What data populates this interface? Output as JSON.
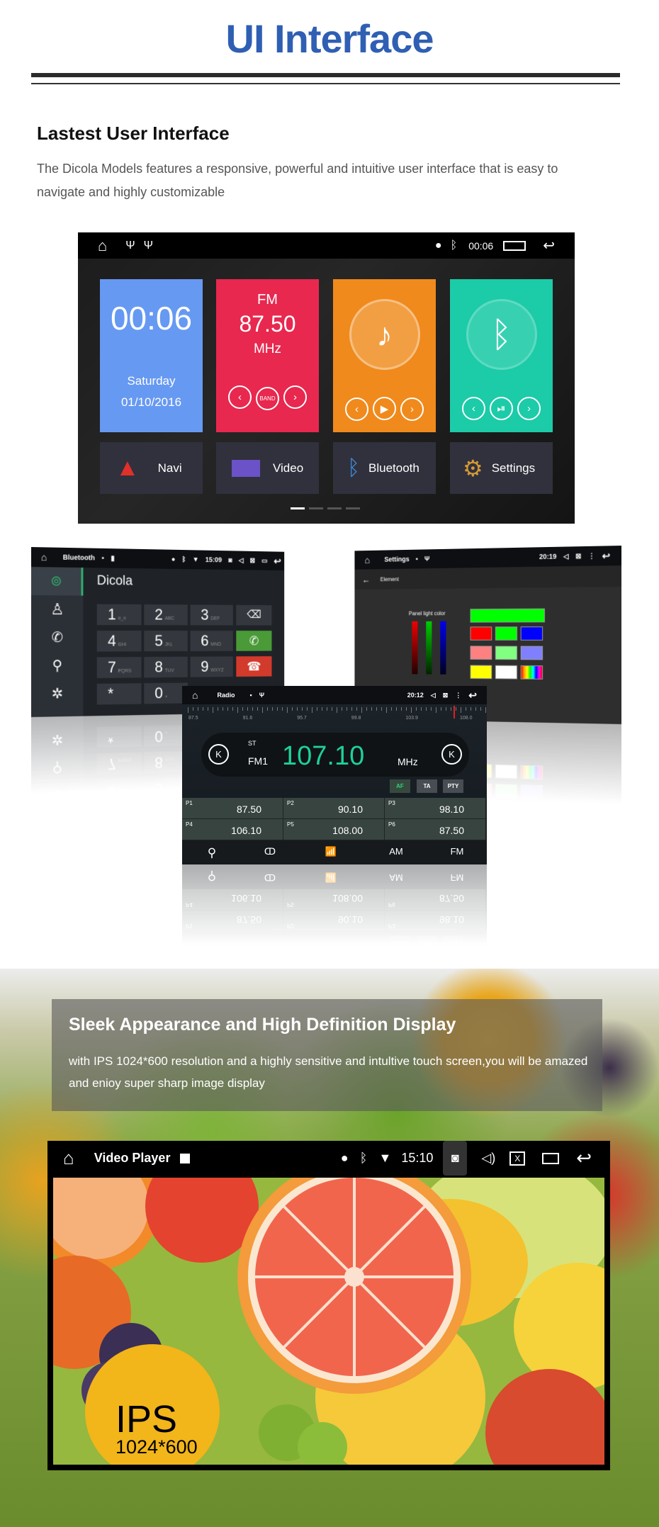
{
  "header": {
    "title": "UI Interface",
    "subtitle": "Lastest User Interface",
    "intro": "The Dicola Models features a responsive, powerful and intuitive user interface that is easy to navigate and highly customizable"
  },
  "home_screen": {
    "status_time": "00:06",
    "clock": {
      "time": "00:06",
      "day": "Saturday",
      "date": "01/10/2016",
      "color": "#6699f2"
    },
    "radio": {
      "band": "FM",
      "freq": "87.50",
      "unit": "MHz",
      "band_btn": "BAND",
      "color": "#e8284f"
    },
    "music": {
      "color": "#f08a1c"
    },
    "bt": {
      "color": "#1ccba8"
    },
    "apps": [
      {
        "label": "Navi",
        "icon": "navigation-arrow-icon"
      },
      {
        "label": "Video",
        "icon": "video-camera-icon"
      },
      {
        "label": "Bluetooth",
        "icon": "bluetooth-icon"
      },
      {
        "label": "Settings",
        "icon": "gear-icon"
      }
    ],
    "page": 1,
    "pages": 4
  },
  "dialer": {
    "title": "Bluetooth",
    "time": "15:09",
    "name": "Dicola",
    "keys": [
      {
        "d": "1",
        "l": "o_o"
      },
      {
        "d": "2",
        "l": "ABC"
      },
      {
        "d": "3",
        "l": "DEF"
      },
      {
        "d": "4",
        "l": "GHI"
      },
      {
        "d": "5",
        "l": "JKL"
      },
      {
        "d": "6",
        "l": "MNO"
      },
      {
        "d": "7",
        "l": "PQRS"
      },
      {
        "d": "8",
        "l": "TUV"
      },
      {
        "d": "9",
        "l": "WXYZ"
      },
      {
        "d": "*",
        "l": ""
      },
      {
        "d": "0",
        "l": "+"
      }
    ]
  },
  "settings": {
    "title": "Settings",
    "time": "20:19",
    "section": "Element",
    "label": "Panel light color",
    "selected": "#00ff00",
    "swatches": [
      "#ff0000",
      "#00ff00",
      "#0000ff",
      "#ff8080",
      "#80ff80",
      "#8080ff",
      "#ffff00",
      "#ffffff",
      "rainbow"
    ]
  },
  "radio": {
    "title": "Radio",
    "time": "20:12",
    "scale": [
      "87.5",
      "91.6",
      "95.7",
      "99.8",
      "103.9",
      "108.0"
    ],
    "stereo": "ST",
    "band": "FM1",
    "freq": "107.10",
    "unit": "MHz",
    "tags": [
      "AF",
      "TA",
      "PTY"
    ],
    "presets": [
      {
        "p": "P1",
        "f": "87.50"
      },
      {
        "p": "P2",
        "f": "90.10"
      },
      {
        "p": "P3",
        "f": "98.10"
      },
      {
        "p": "P4",
        "f": "106.10"
      },
      {
        "p": "P5",
        "f": "108.00"
      },
      {
        "p": "P6",
        "f": "87.50"
      }
    ],
    "bottom": {
      "am": "AM",
      "fm": "FM"
    }
  },
  "display": {
    "heading": "Sleek Appearance and High Definition Display",
    "text": "with IPS 1024*600 resolution and a highly sensitive and intultive touch screen,you will be amazed and enioy super sharp image display"
  },
  "video_player": {
    "title": "Video Player",
    "time": "15:10",
    "panel": "IPS",
    "resolution": "1024*600"
  }
}
